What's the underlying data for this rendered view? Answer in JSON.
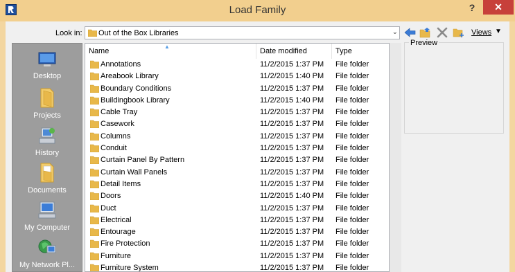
{
  "window": {
    "title": "Load Family",
    "help_label": "?",
    "close_label": "✕"
  },
  "lookin": {
    "label": "Look in:",
    "value": "Out of the Box Libraries"
  },
  "toolbar": {
    "views_label": "Views"
  },
  "places": [
    {
      "label": "Desktop",
      "icon": "desktop-icon"
    },
    {
      "label": "Projects",
      "icon": "projects-folder-icon"
    },
    {
      "label": "History",
      "icon": "history-icon"
    },
    {
      "label": "Documents",
      "icon": "documents-icon"
    },
    {
      "label": "My Computer",
      "icon": "my-computer-icon"
    },
    {
      "label": "My Network Pl...",
      "icon": "network-icon"
    }
  ],
  "columns": {
    "name": "Name",
    "date": "Date modified",
    "type": "Type"
  },
  "files": [
    {
      "name": "Annotations",
      "date": "11/2/2015 1:37 PM",
      "type": "File folder"
    },
    {
      "name": "Areabook Library",
      "date": "11/2/2015 1:40 PM",
      "type": "File folder"
    },
    {
      "name": "Boundary Conditions",
      "date": "11/2/2015 1:37 PM",
      "type": "File folder"
    },
    {
      "name": "Buildingbook Library",
      "date": "11/2/2015 1:40 PM",
      "type": "File folder"
    },
    {
      "name": "Cable Tray",
      "date": "11/2/2015 1:37 PM",
      "type": "File folder"
    },
    {
      "name": "Casework",
      "date": "11/2/2015 1:37 PM",
      "type": "File folder"
    },
    {
      "name": "Columns",
      "date": "11/2/2015 1:37 PM",
      "type": "File folder"
    },
    {
      "name": "Conduit",
      "date": "11/2/2015 1:37 PM",
      "type": "File folder"
    },
    {
      "name": "Curtain Panel By Pattern",
      "date": "11/2/2015 1:37 PM",
      "type": "File folder"
    },
    {
      "name": "Curtain Wall Panels",
      "date": "11/2/2015 1:37 PM",
      "type": "File folder"
    },
    {
      "name": "Detail Items",
      "date": "11/2/2015 1:37 PM",
      "type": "File folder"
    },
    {
      "name": "Doors",
      "date": "11/2/2015 1:40 PM",
      "type": "File folder"
    },
    {
      "name": "Duct",
      "date": "11/2/2015 1:37 PM",
      "type": "File folder"
    },
    {
      "name": "Electrical",
      "date": "11/2/2015 1:37 PM",
      "type": "File folder"
    },
    {
      "name": "Entourage",
      "date": "11/2/2015 1:37 PM",
      "type": "File folder"
    },
    {
      "name": "Fire Protection",
      "date": "11/2/2015 1:37 PM",
      "type": "File folder"
    },
    {
      "name": "Furniture",
      "date": "11/2/2015 1:37 PM",
      "type": "File folder"
    },
    {
      "name": "Furniture System",
      "date": "11/2/2015 1:37 PM",
      "type": "File folder"
    }
  ],
  "preview": {
    "label": "Preview"
  },
  "colors": {
    "titlebar": "#f2cf8e",
    "close": "#c7403a",
    "places_bg": "#9d9d9d",
    "folder": "#e8b84a"
  }
}
